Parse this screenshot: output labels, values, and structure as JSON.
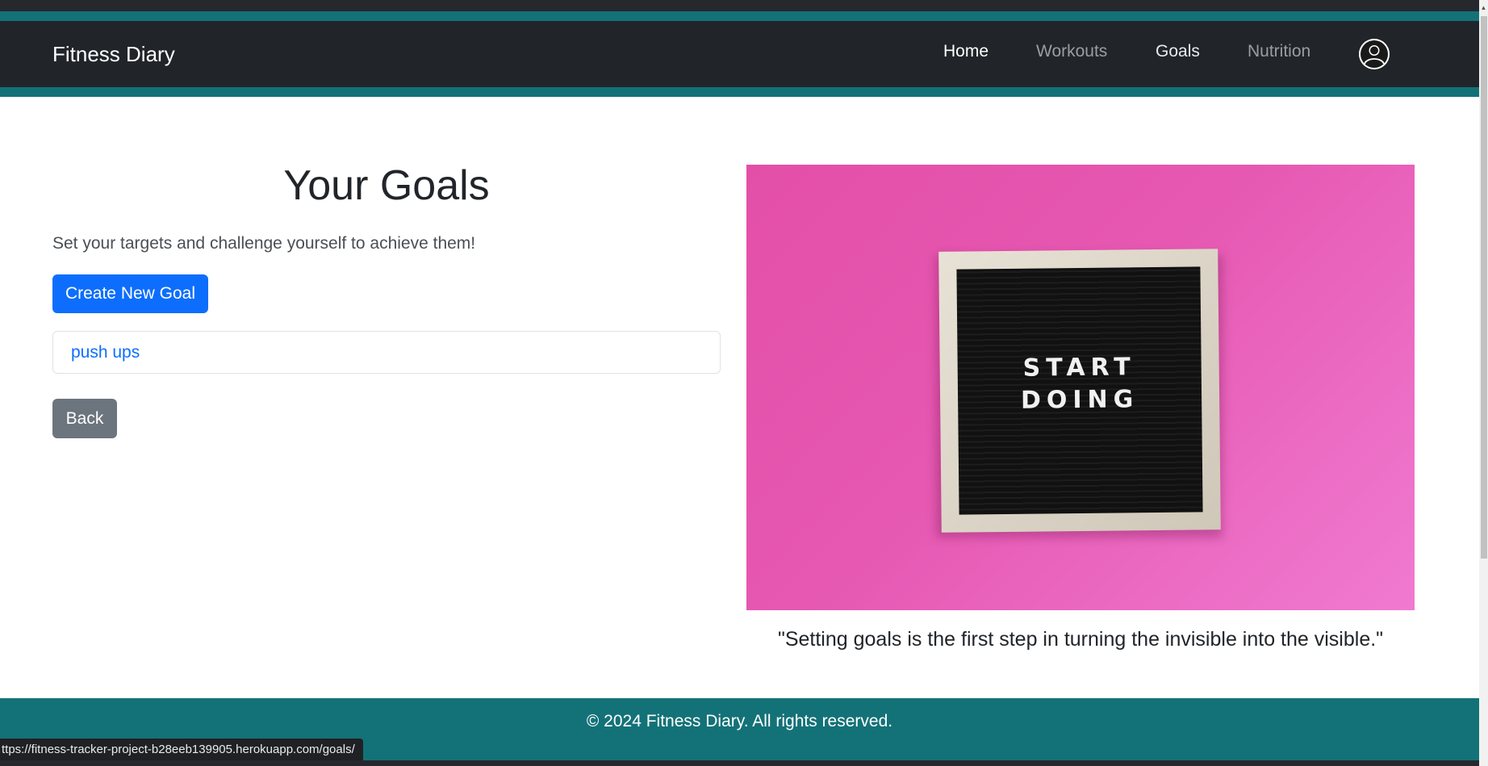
{
  "navbar": {
    "brand": "Fitness Diary",
    "links": [
      {
        "label": "Home"
      },
      {
        "label": "Workouts"
      },
      {
        "label": "Goals"
      },
      {
        "label": "Nutrition"
      }
    ],
    "avatar_icon": "user-circle-icon"
  },
  "main": {
    "title": "Your Goals",
    "subtitle": "Set your targets and challenge yourself to achieve them!",
    "create_button": "Create New Goal",
    "goals": [
      {
        "label": "push ups"
      }
    ],
    "back_button": "Back"
  },
  "image": {
    "board_line1": "START",
    "board_line2": "DOING"
  },
  "quote": "\"Setting goals is the first step in turning the invisible into the visible.\"",
  "footer": {
    "text": "© 2024 Fitness Diary. All rights reserved."
  },
  "status_bar": {
    "url": "ttps://fitness-tracker-project-b28eeb139905.herokuapp.com/goals/"
  },
  "colors": {
    "navbar": "#212529",
    "teal": "#137277",
    "primary": "#0d6efd",
    "secondary": "#6c757d",
    "image_background": "#e658b2"
  }
}
